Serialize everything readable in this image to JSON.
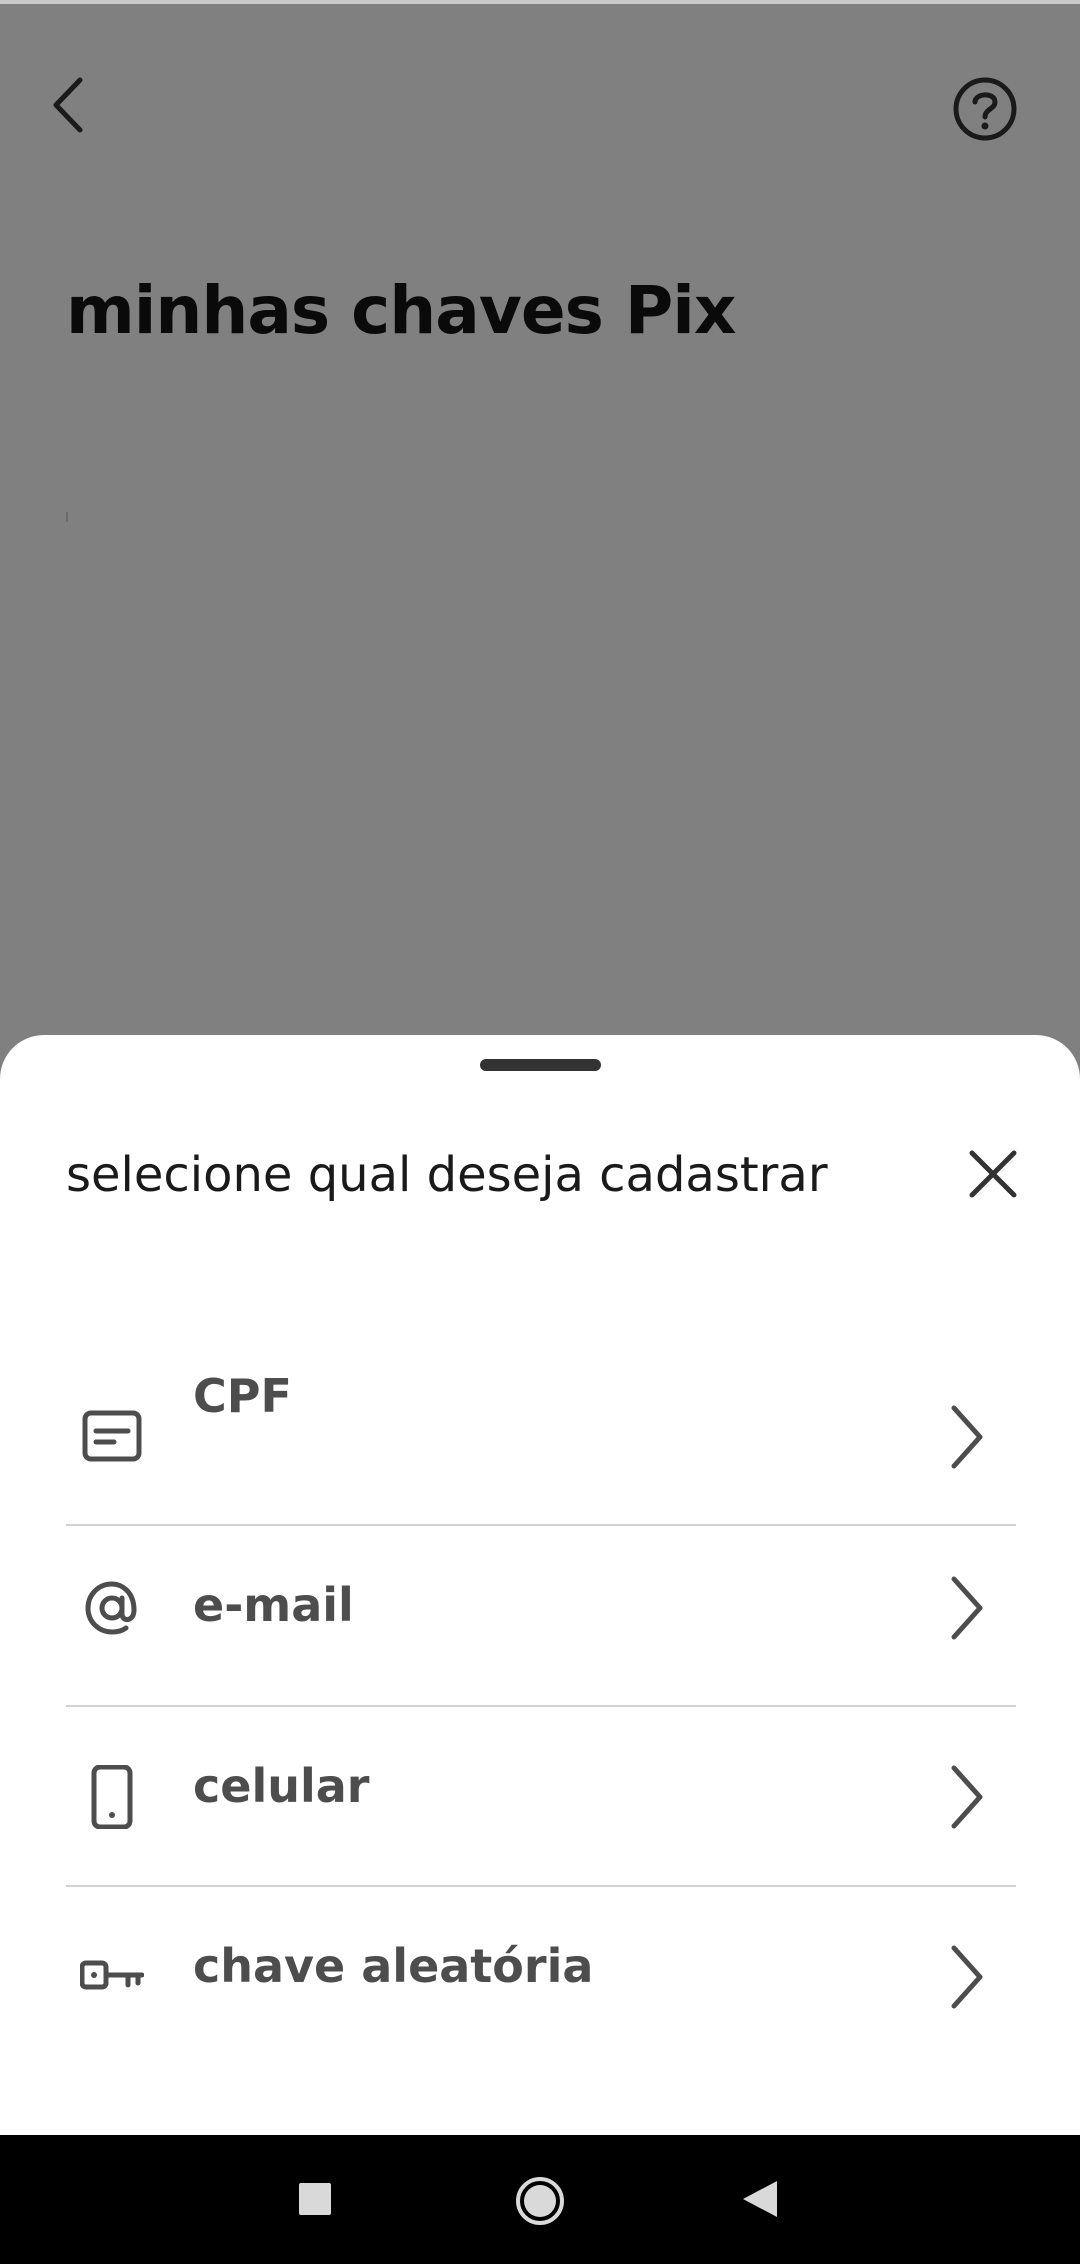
{
  "header": {
    "title": "minhas chaves Pix",
    "back_icon": "chevron-left-icon",
    "help_icon": "question-circle-icon"
  },
  "sheet": {
    "title": "selecione qual deseja cadastrar",
    "close_icon": "close-icon",
    "options": [
      {
        "label": "CPF",
        "icon": "document-card-icon"
      },
      {
        "label": "e-mail",
        "icon": "at-sign-icon"
      },
      {
        "label": "celular",
        "icon": "mobile-phone-icon"
      },
      {
        "label": "chave aleatória",
        "icon": "key-icon"
      }
    ]
  },
  "navbar": {
    "recents_icon": "square-icon",
    "home_icon": "circle-icon",
    "back_icon": "triangle-back-icon"
  },
  "colors": {
    "overlay_background": "#808080",
    "sheet_background": "#ffffff",
    "label_text": "#4d4d4d",
    "navbar": "#000000"
  }
}
